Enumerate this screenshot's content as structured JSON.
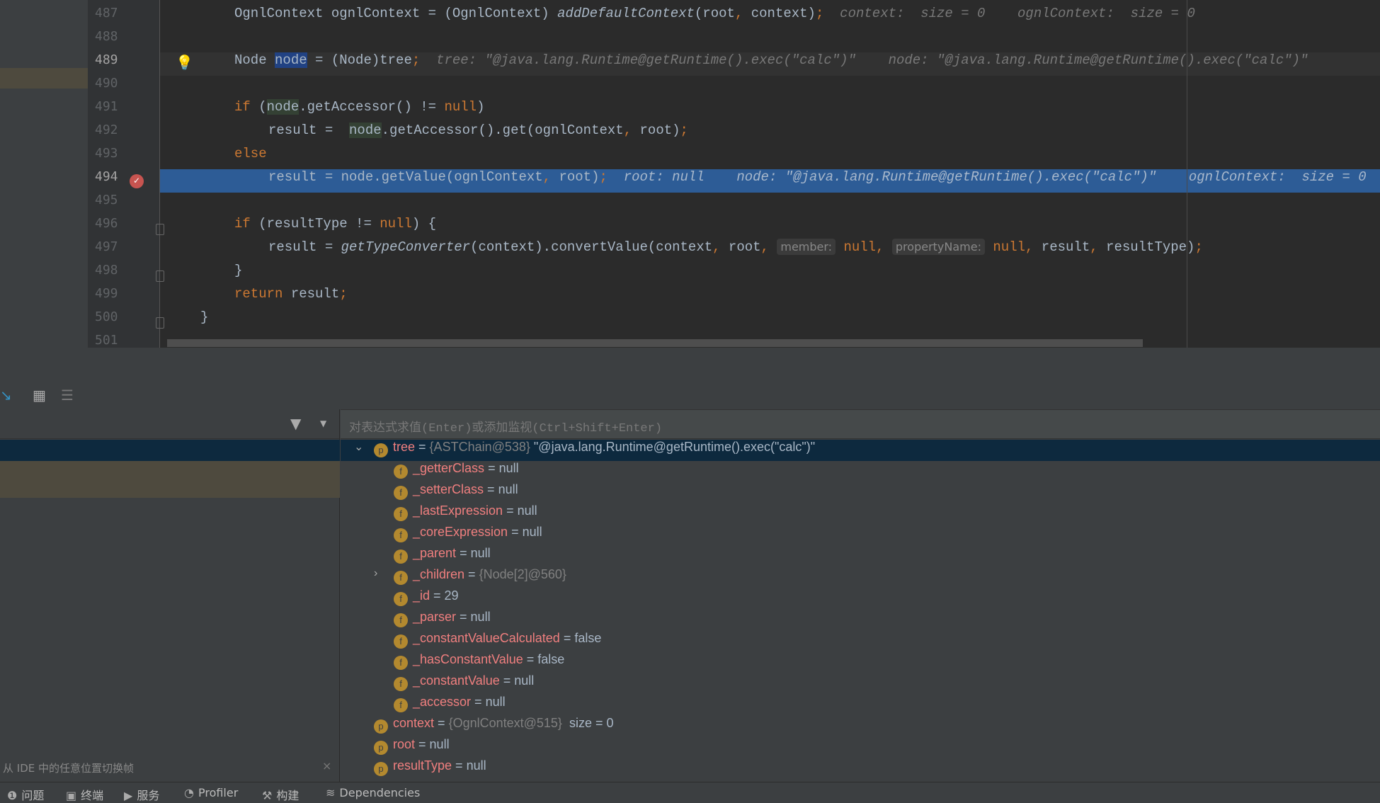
{
  "editor": {
    "lines": [
      {
        "n": "487",
        "indent": 1,
        "tokens": [
          {
            "t": "OgnlContext ognlContext = (OgnlContext) "
          },
          {
            "t": "addDefaultContext",
            "c": "it"
          },
          {
            "t": "(root"
          },
          {
            "t": ",",
            "c": "kw"
          },
          {
            "t": " context)"
          },
          {
            "t": ";",
            "c": "kw"
          },
          {
            "t": "  context:  size = 0    ognlContext:  size = 0",
            "c": "hint"
          }
        ]
      },
      {
        "n": "488",
        "indent": 1,
        "tokens": []
      },
      {
        "n": "489",
        "indent": 1,
        "state": "cur",
        "tokens": [
          {
            "t": "Node "
          },
          {
            "t": "node",
            "c": "sel"
          },
          {
            "t": " = (Node)tree"
          },
          {
            "t": ";",
            "c": "kw"
          },
          {
            "t": "  tree: \"@java.lang.Runtime@getRuntime().exec(\"calc\")\"    node: \"@java.lang.Runtime@getRuntime().exec(\"calc\")\"",
            "c": "hint"
          }
        ]
      },
      {
        "n": "490",
        "indent": 1,
        "tokens": []
      },
      {
        "n": "491",
        "indent": 1,
        "tokens": [
          {
            "t": "if",
            "c": "kw"
          },
          {
            "t": " ("
          },
          {
            "t": "node",
            "c": "hl"
          },
          {
            "t": ".getAccessor() != "
          },
          {
            "t": "null",
            "c": "kw"
          },
          {
            "t": ")"
          }
        ]
      },
      {
        "n": "492",
        "indent": 2,
        "tokens": [
          {
            "t": "result =  "
          },
          {
            "t": "node",
            "c": "hl"
          },
          {
            "t": ".getAccessor().get(ognlContext"
          },
          {
            "t": ",",
            "c": "kw"
          },
          {
            "t": " root)"
          },
          {
            "t": ";",
            "c": "kw"
          }
        ]
      },
      {
        "n": "493",
        "indent": 1,
        "tokens": [
          {
            "t": "else",
            "c": "kw"
          }
        ]
      },
      {
        "n": "494",
        "indent": 2,
        "state": "exec",
        "tokens": [
          {
            "t": "result = node.getValue(ognlContext"
          },
          {
            "t": ",",
            "c": "kw"
          },
          {
            "t": " root)"
          },
          {
            "t": ";",
            "c": "kw"
          },
          {
            "t": "  root: null    node: \"@java.lang.Runtime@getRuntime().exec(\"calc\")\"    ognlContext:  size = 0",
            "c": "hint"
          }
        ]
      },
      {
        "n": "495",
        "indent": 1,
        "tokens": []
      },
      {
        "n": "496",
        "indent": 1,
        "tokens": [
          {
            "t": "if",
            "c": "kw"
          },
          {
            "t": " (resultType != "
          },
          {
            "t": "null",
            "c": "kw"
          },
          {
            "t": ") {"
          }
        ]
      },
      {
        "n": "497",
        "indent": 2,
        "tokens": [
          {
            "t": "result = "
          },
          {
            "t": "getTypeConverter",
            "c": "it"
          },
          {
            "t": "(context).convertValue(context"
          },
          {
            "t": ",",
            "c": "kw"
          },
          {
            "t": " root"
          },
          {
            "t": ",",
            "c": "kw"
          },
          {
            "t": " "
          },
          {
            "t": "member:",
            "c": "ph"
          },
          {
            "t": " "
          },
          {
            "t": "null",
            "c": "kw"
          },
          {
            "t": ",",
            "c": "kw"
          },
          {
            "t": " "
          },
          {
            "t": "propertyName:",
            "c": "ph"
          },
          {
            "t": " "
          },
          {
            "t": "null",
            "c": "kw"
          },
          {
            "t": ",",
            "c": "kw"
          },
          {
            "t": " result"
          },
          {
            "t": ",",
            "c": "kw"
          },
          {
            "t": " resultType)"
          },
          {
            "t": ";",
            "c": "kw"
          }
        ]
      },
      {
        "n": "498",
        "indent": 1,
        "tokens": [
          {
            "t": "}"
          }
        ]
      },
      {
        "n": "499",
        "indent": 1,
        "tokens": [
          {
            "t": "return",
            "c": "kw"
          },
          {
            "t": " result"
          },
          {
            "t": ";",
            "c": "kw"
          }
        ]
      },
      {
        "n": "500",
        "indent": 0,
        "tokens": [
          {
            "t": "}"
          }
        ]
      },
      {
        "n": "501",
        "indent": 0,
        "tokens": []
      }
    ]
  },
  "evaluate": {
    "placeholder": "对表达式求值(Enter)或添加监视(Ctrl+Shift+Enter)"
  },
  "frames": {
    "hint": "从 IDE 中的任意位置切换帧",
    "close": "×"
  },
  "variables": [
    {
      "badge": "p",
      "level": 0,
      "expand": "down",
      "name": "tree",
      "eq": " = ",
      "gray": "{ASTChain@538} ",
      "value": "\"@java.lang.Runtime@getRuntime().exec(\"calc\")\"",
      "selected": true
    },
    {
      "badge": "f",
      "level": 1,
      "name": "_getterClass",
      "eq": " = ",
      "value": "null"
    },
    {
      "badge": "f",
      "level": 1,
      "name": "_setterClass",
      "eq": " = ",
      "value": "null"
    },
    {
      "badge": "f",
      "level": 1,
      "name": "_lastExpression",
      "eq": " = ",
      "value": "null"
    },
    {
      "badge": "f",
      "level": 1,
      "name": "_coreExpression",
      "eq": " = ",
      "value": "null"
    },
    {
      "badge": "f",
      "level": 1,
      "name": "_parent",
      "eq": " = ",
      "value": "null"
    },
    {
      "badge": "f",
      "level": 1,
      "expand": "right",
      "name": "_children",
      "eq": " = ",
      "gray": "{Node[2]@560}",
      "value": ""
    },
    {
      "badge": "f",
      "level": 1,
      "name": "_id",
      "eq": " = ",
      "value": "29"
    },
    {
      "badge": "f",
      "level": 1,
      "name": "_parser",
      "eq": " = ",
      "value": "null"
    },
    {
      "badge": "f",
      "level": 1,
      "name": "_constantValueCalculated",
      "eq": " = ",
      "value": "false"
    },
    {
      "badge": "f",
      "level": 1,
      "name": "_hasConstantValue",
      "eq": " = ",
      "value": "false"
    },
    {
      "badge": "f",
      "level": 1,
      "name": "_constantValue",
      "eq": " = ",
      "value": "null"
    },
    {
      "badge": "f",
      "level": 1,
      "name": "_accessor",
      "eq": " = ",
      "value": "null"
    },
    {
      "badge": "p",
      "level": 0,
      "name": "context",
      "eq": " = ",
      "gray": "{OgnlContext@515} ",
      "value": " size = 0"
    },
    {
      "badge": "p",
      "level": 0,
      "name": "root",
      "eq": " = ",
      "value": "null"
    },
    {
      "badge": "p",
      "level": 0,
      "name": "resultType",
      "eq": " = ",
      "value": "null"
    }
  ],
  "statusbar": [
    {
      "icon": "problems-icon",
      "glyph": "❶",
      "label": "问题"
    },
    {
      "icon": "terminal-icon",
      "glyph": "▣",
      "label": "终端"
    },
    {
      "icon": "services-icon",
      "glyph": "▶",
      "label": "服务"
    },
    {
      "icon": "profiler-icon",
      "glyph": "◔",
      "label": "Profiler"
    },
    {
      "icon": "build-icon",
      "glyph": "⚒",
      "label": "构建"
    },
    {
      "icon": "dependencies-icon",
      "glyph": "≋",
      "label": "Dependencies"
    }
  ]
}
